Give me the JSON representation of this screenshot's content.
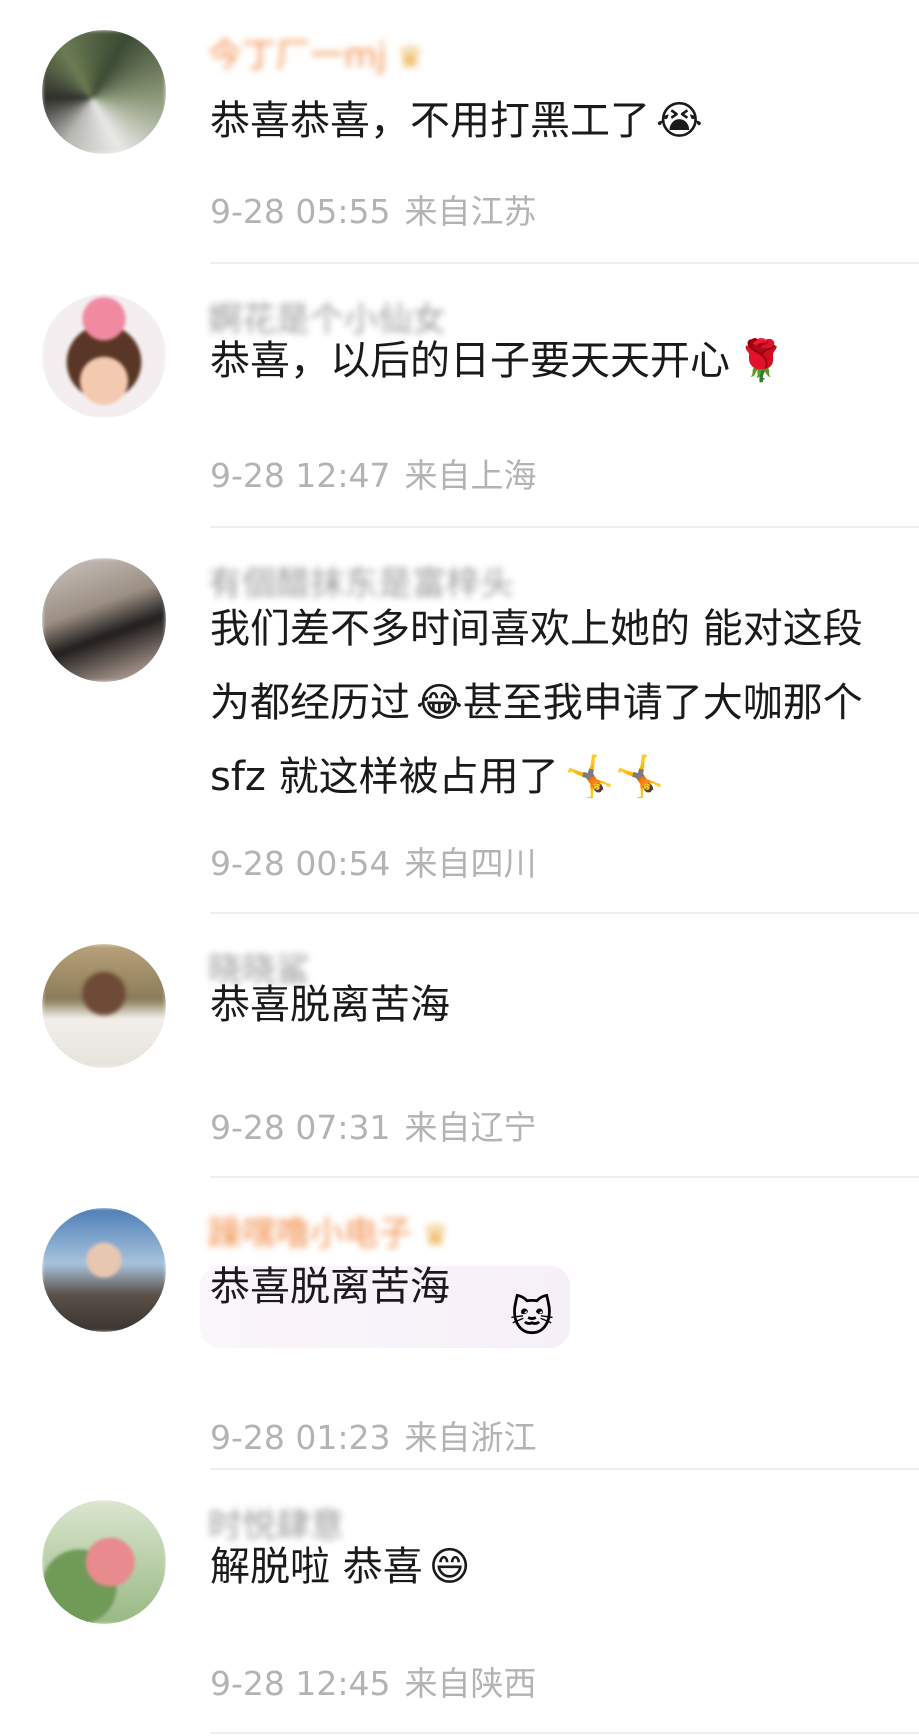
{
  "comments": [
    {
      "username": "今丁厂一mj",
      "username_color": "#f07a2a",
      "badge_icon": "crown-icon",
      "text": "恭喜恭喜，不用打黑工了",
      "emoji": "😭",
      "time": "9-28 05:55",
      "location": "来自江苏"
    },
    {
      "username": "婀花是个小仙女",
      "username_color": "#8a8a8a",
      "text": "恭喜，以后的日子要天天开心",
      "emoji": "🌹",
      "time": "9-28 12:47",
      "location": "来自上海"
    },
    {
      "username": "有個醋抹东是富梓头",
      "username_color": "#8a8a8a",
      "lines": [
        "我们差不多时间喜欢上她的 能对这段",
        "为都经历过",
        "甚至我申请了大咖那个",
        "sfz 就这样被占用了"
      ],
      "emoji_line2": "😂",
      "emoji_line3": "🤸🤸",
      "time": "9-28 00:54",
      "location": "来自四川"
    },
    {
      "username": "晓晓鲨",
      "username_color": "#8a8a8a",
      "text": "恭喜脱离苦海",
      "time": "9-28 07:31",
      "location": "来自辽宁"
    },
    {
      "username": "躁嘿噜小电子",
      "username_color": "#f07a2a",
      "badge_icon": "crown-icon",
      "text": "恭喜脱离苦海",
      "sticker": "🐱",
      "time": "9-28 01:23",
      "location": "来自浙江"
    },
    {
      "username": "时悦肆意",
      "username_color": "#8a8a8a",
      "text": "解脱啦 恭喜",
      "emoji": "😄",
      "time": "9-28 12:45",
      "location": "来自陕西"
    }
  ]
}
